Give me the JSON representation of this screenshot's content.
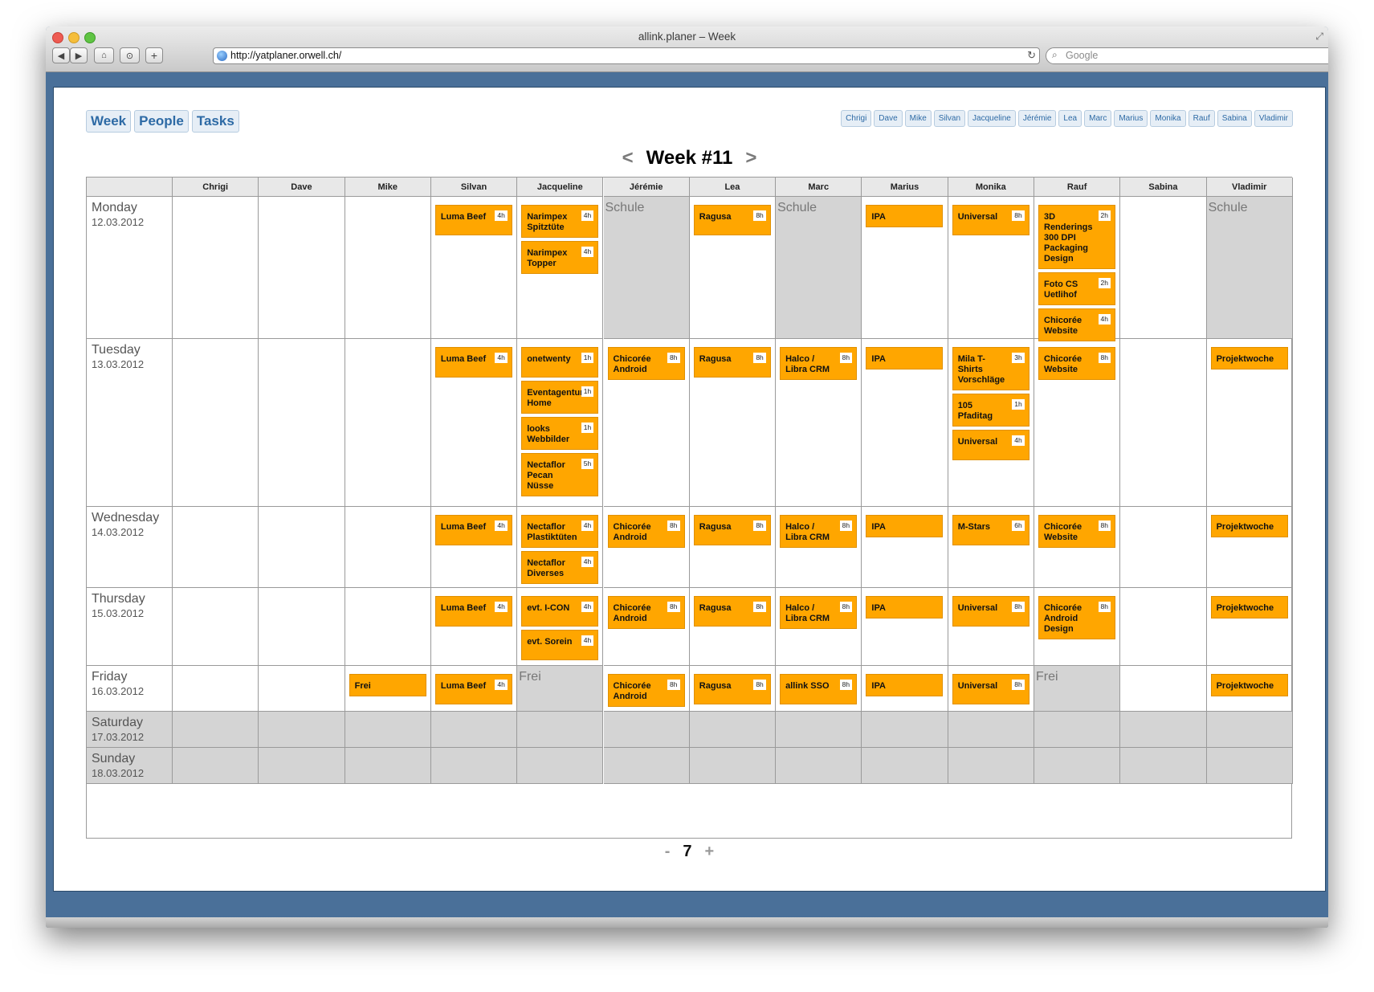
{
  "browser": {
    "window_title": "allink.planer – Week",
    "url": "http://yatplaner.orwell.ch/",
    "search_placeholder": "Google",
    "add_tab_label": "+"
  },
  "nav": {
    "week": "Week",
    "people": "People",
    "tasks": "Tasks"
  },
  "people": [
    "Chrigi",
    "Dave",
    "Mike",
    "Silvan",
    "Jacqueline",
    "Jérémie",
    "Lea",
    "Marc",
    "Marius",
    "Monika",
    "Rauf",
    "Sabina",
    "Vladimir"
  ],
  "week": {
    "title": "Week #11",
    "prev": "<",
    "next": ">"
  },
  "zoom": {
    "minus": "-",
    "value": "7",
    "plus": "+"
  },
  "days": [
    {
      "name": "Monday",
      "date": "12.03.2012",
      "weekend": false,
      "cells": [
        null,
        null,
        null,
        {
          "cards": [
            {
              "title": "Luma Beef",
              "hours": "4h"
            }
          ]
        },
        {
          "cards": [
            {
              "title": "Narimpex Spitztüte",
              "hours": "4h"
            },
            {
              "title": "Narimpex Topper",
              "hours": "4h"
            }
          ]
        },
        {
          "status": "Schule"
        },
        {
          "cards": [
            {
              "title": "Ragusa",
              "hours": "8h"
            }
          ]
        },
        {
          "status": "Schule"
        },
        {
          "cards": [
            {
              "title": "IPA"
            }
          ]
        },
        {
          "cards": [
            {
              "title": "Universal",
              "hours": "8h"
            }
          ]
        },
        {
          "cards": [
            {
              "title": "3D Renderings 300 DPI Packaging Design",
              "hours": "2h"
            },
            {
              "title": "Foto CS Uetlihof",
              "hours": "2h"
            },
            {
              "title": "Chicorée Website",
              "hours": "4h"
            }
          ]
        },
        null,
        {
          "status": "Schule"
        }
      ]
    },
    {
      "name": "Tuesday",
      "date": "13.03.2012",
      "weekend": false,
      "cells": [
        null,
        null,
        null,
        {
          "cards": [
            {
              "title": "Luma Beef",
              "hours": "4h"
            }
          ]
        },
        {
          "cards": [
            {
              "title": "onetwenty",
              "hours": "1h"
            },
            {
              "title": "Eventagentur Home",
              "hours": "1h"
            },
            {
              "title": "looks Webbilder",
              "hours": "1h"
            },
            {
              "title": "Nectaflor Pecan Nüsse",
              "hours": "5h"
            }
          ]
        },
        {
          "cards": [
            {
              "title": "Chicorée Android",
              "hours": "8h"
            }
          ]
        },
        {
          "cards": [
            {
              "title": "Ragusa",
              "hours": "8h"
            }
          ]
        },
        {
          "cards": [
            {
              "title": "Halco / Libra CRM",
              "hours": "8h"
            }
          ]
        },
        {
          "cards": [
            {
              "title": "IPA"
            }
          ]
        },
        {
          "cards": [
            {
              "title": "Mila T-Shirts Vorschläge",
              "hours": "3h"
            },
            {
              "title": "105 Pfaditag",
              "hours": "1h"
            },
            {
              "title": "Universal",
              "hours": "4h"
            }
          ]
        },
        {
          "cards": [
            {
              "title": "Chicorée Website",
              "hours": "8h"
            }
          ]
        },
        null,
        {
          "cards": [
            {
              "title": "Projektwoche"
            }
          ]
        }
      ]
    },
    {
      "name": "Wednesday",
      "date": "14.03.2012",
      "weekend": false,
      "cells": [
        null,
        null,
        null,
        {
          "cards": [
            {
              "title": "Luma Beef",
              "hours": "4h"
            }
          ]
        },
        {
          "cards": [
            {
              "title": "Nectaflor Plastiktüten",
              "hours": "4h"
            },
            {
              "title": "Nectaflor Diverses",
              "hours": "4h"
            }
          ]
        },
        {
          "cards": [
            {
              "title": "Chicorée Android",
              "hours": "8h"
            }
          ]
        },
        {
          "cards": [
            {
              "title": "Ragusa",
              "hours": "8h"
            }
          ]
        },
        {
          "cards": [
            {
              "title": "Halco / Libra CRM",
              "hours": "8h"
            }
          ]
        },
        {
          "cards": [
            {
              "title": "IPA"
            }
          ]
        },
        {
          "cards": [
            {
              "title": "M-Stars",
              "hours": "6h"
            }
          ]
        },
        {
          "cards": [
            {
              "title": "Chicorée Website",
              "hours": "8h"
            }
          ]
        },
        null,
        {
          "cards": [
            {
              "title": "Projektwoche"
            }
          ]
        }
      ]
    },
    {
      "name": "Thursday",
      "date": "15.03.2012",
      "weekend": false,
      "cells": [
        null,
        null,
        null,
        {
          "cards": [
            {
              "title": "Luma Beef",
              "hours": "4h"
            }
          ]
        },
        {
          "cards": [
            {
              "title": "evt. I-CON",
              "hours": "4h"
            },
            {
              "title": "evt. Sorein",
              "hours": "4h"
            }
          ]
        },
        {
          "cards": [
            {
              "title": "Chicorée Android",
              "hours": "8h"
            }
          ]
        },
        {
          "cards": [
            {
              "title": "Ragusa",
              "hours": "8h"
            }
          ]
        },
        {
          "cards": [
            {
              "title": "Halco / Libra CRM",
              "hours": "8h"
            }
          ]
        },
        {
          "cards": [
            {
              "title": "IPA"
            }
          ]
        },
        {
          "cards": [
            {
              "title": "Universal",
              "hours": "8h"
            }
          ]
        },
        {
          "cards": [
            {
              "title": "Chicorée Android Design",
              "hours": "8h"
            }
          ]
        },
        null,
        {
          "cards": [
            {
              "title": "Projektwoche"
            }
          ]
        }
      ]
    },
    {
      "name": "Friday",
      "date": "16.03.2012",
      "weekend": false,
      "cells": [
        null,
        null,
        {
          "cards": [
            {
              "title": "Frei"
            }
          ]
        },
        {
          "cards": [
            {
              "title": "Luma Beef",
              "hours": "4h"
            }
          ]
        },
        {
          "status": "Frei"
        },
        {
          "cards": [
            {
              "title": "Chicorée Android",
              "hours": "8h"
            }
          ]
        },
        {
          "cards": [
            {
              "title": "Ragusa",
              "hours": "8h"
            }
          ]
        },
        {
          "cards": [
            {
              "title": "allink SSO",
              "hours": "8h"
            }
          ]
        },
        {
          "cards": [
            {
              "title": "IPA"
            }
          ]
        },
        {
          "cards": [
            {
              "title": "Universal",
              "hours": "8h"
            }
          ]
        },
        {
          "status": "Frei"
        },
        null,
        {
          "cards": [
            {
              "title": "Projektwoche"
            }
          ]
        }
      ]
    },
    {
      "name": "Saturday",
      "date": "17.03.2012",
      "weekend": true,
      "cells": []
    },
    {
      "name": "Sunday",
      "date": "18.03.2012",
      "weekend": true,
      "cells": []
    }
  ]
}
